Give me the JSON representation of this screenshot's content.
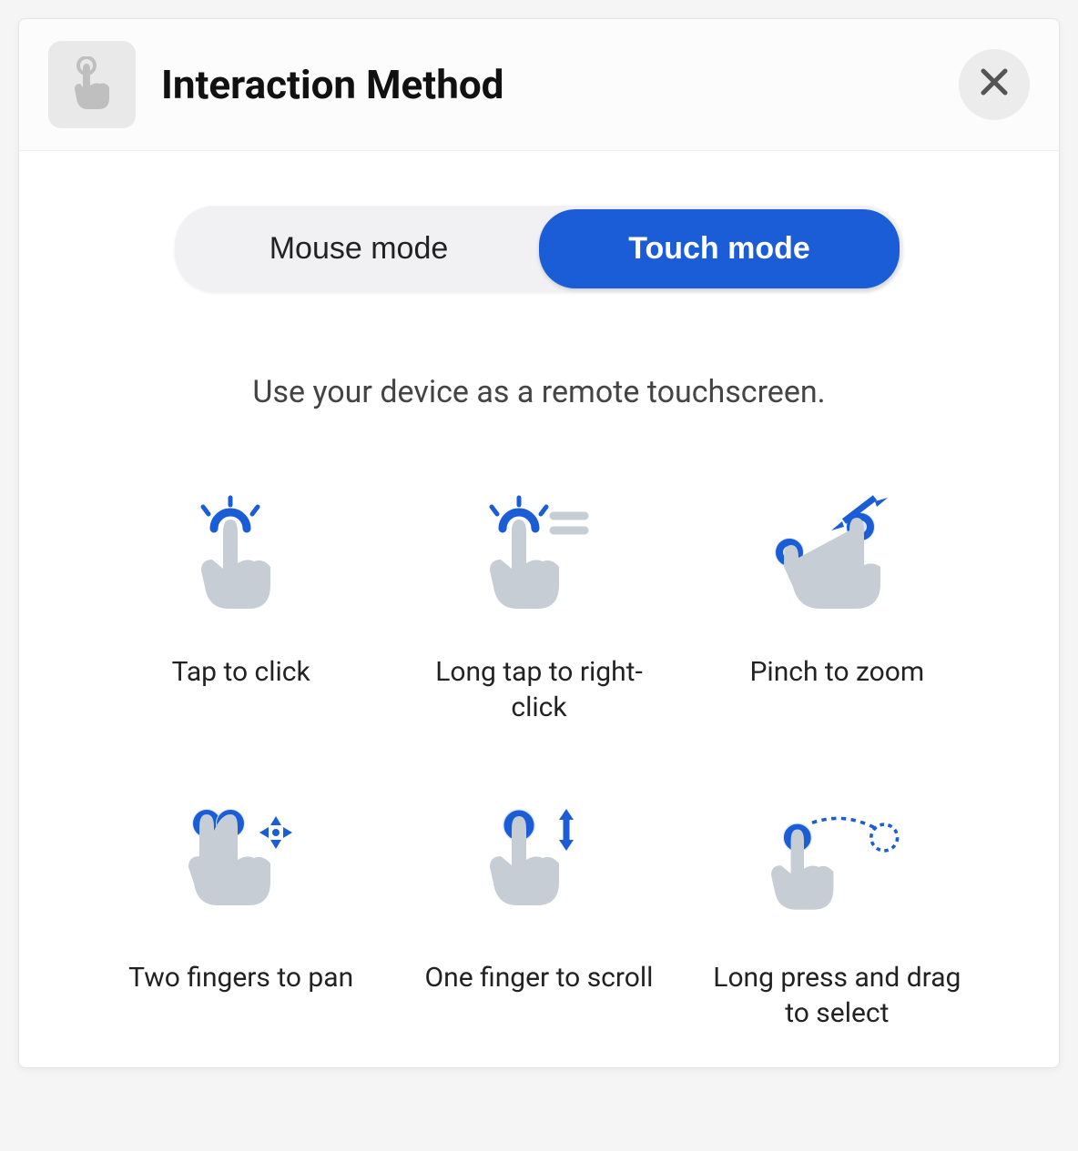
{
  "header": {
    "title": "Interaction Method"
  },
  "segmented": {
    "options": [
      "Mouse mode",
      "Touch mode"
    ],
    "active_index": 1
  },
  "description": "Use your device as a remote touchscreen.",
  "gestures": [
    {
      "label": "Tap to click",
      "icon": "tap-icon"
    },
    {
      "label": "Long tap to right-click",
      "icon": "longtap-icon"
    },
    {
      "label": "Pinch to zoom",
      "icon": "pinch-icon"
    },
    {
      "label": "Two fingers to pan",
      "icon": "pan-icon"
    },
    {
      "label": "One finger to scroll",
      "icon": "scroll-icon"
    },
    {
      "label": "Long press and drag to select",
      "icon": "drag-select-icon"
    }
  ],
  "colors": {
    "accent": "#1a5dd6",
    "icon_fill": "#c7cdd4",
    "icon_outline": "#1a5dd6"
  }
}
